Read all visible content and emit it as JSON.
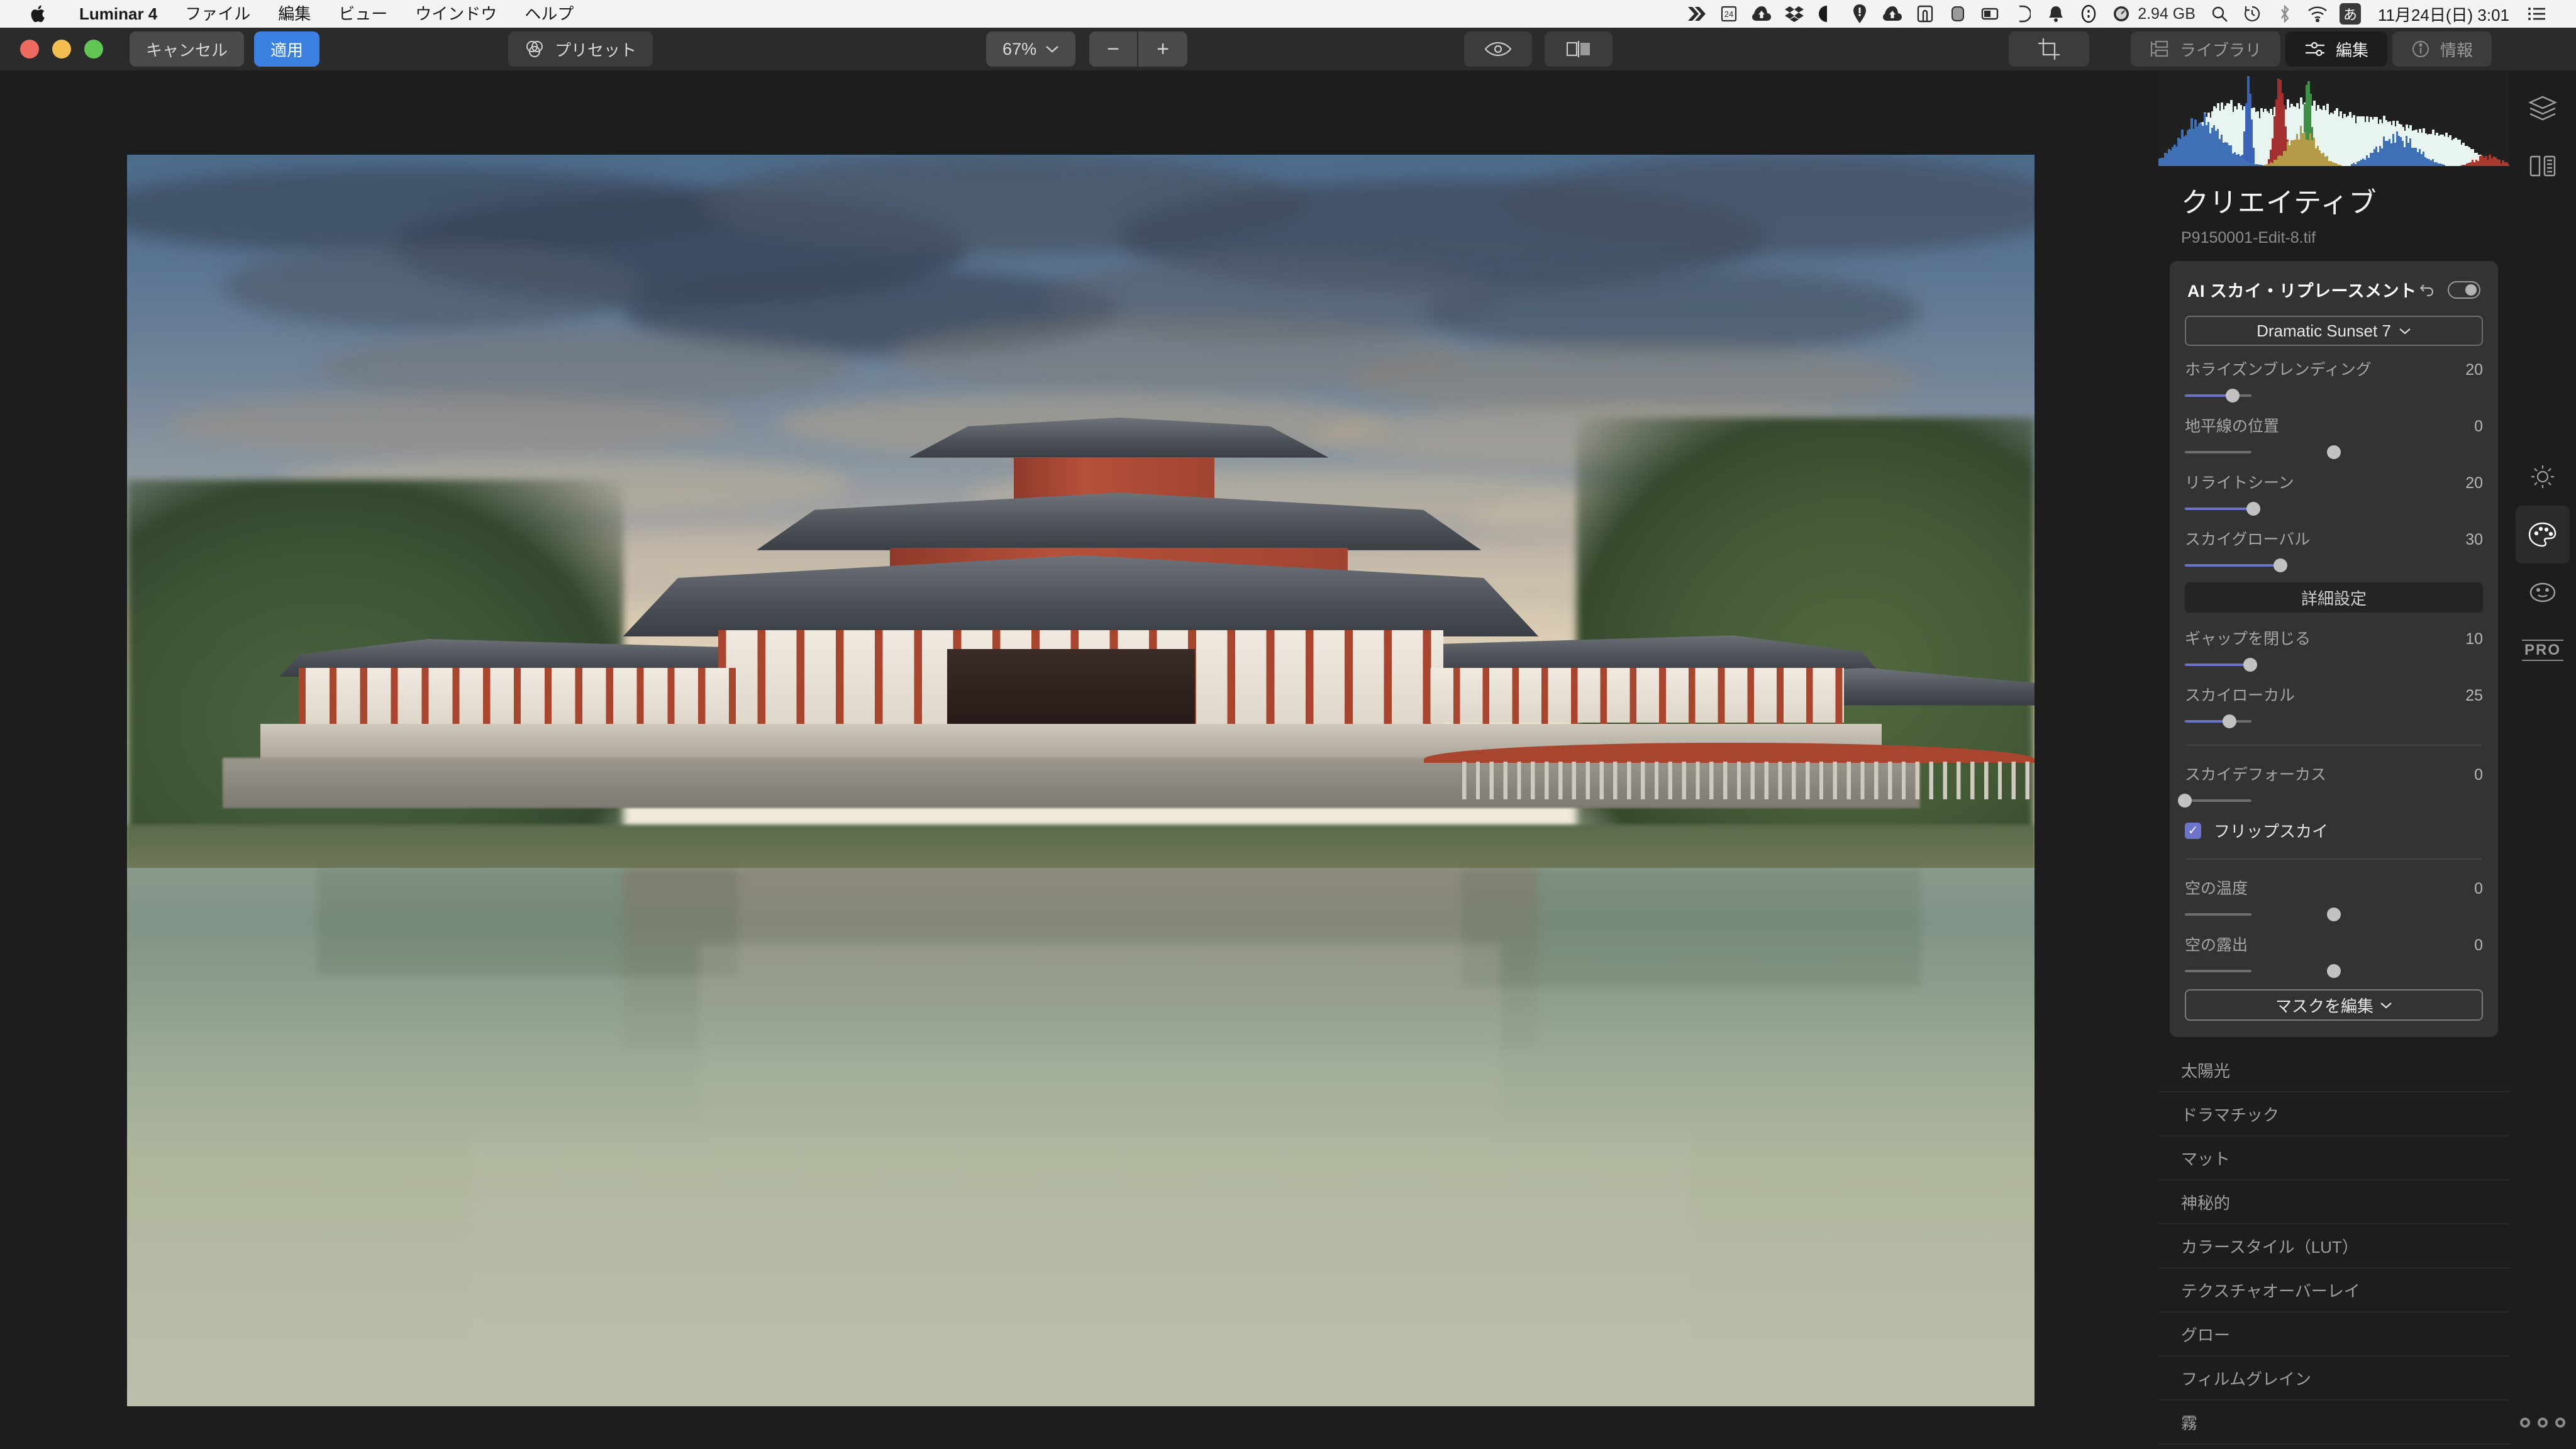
{
  "menubar": {
    "apple_icon": "apple-logo-icon",
    "items": [
      {
        "label": "Luminar 4",
        "bold": true
      },
      {
        "label": "ファイル",
        "bold": false
      },
      {
        "label": "編集",
        "bold": false
      },
      {
        "label": "ビュー",
        "bold": false
      },
      {
        "label": "ウインドウ",
        "bold": false
      },
      {
        "label": "ヘルプ",
        "bold": false
      }
    ],
    "status_icons": [
      "chevrons-right-icon",
      "calendar-24-icon",
      "cloud-upload-icon",
      "dropbox-icon",
      "pacman-icon",
      "location-pin-icon",
      "cloud-upload-2-icon",
      "clipboard-icon",
      "battery-round-icon",
      "battery-icon",
      "moon-icon",
      "bell-icon",
      "info-circle-icon",
      "speedometer-icon"
    ],
    "ram": "2.94 GB",
    "right_icons": [
      "search-icon",
      "time-machine-icon",
      "bluetooth-icon",
      "wifi-icon"
    ],
    "ime": "あ",
    "clock": "11月24日(日) 3:01",
    "control_center": "list-icon"
  },
  "toolbar": {
    "cancel_label": "キャンセル",
    "apply_label": "適用",
    "preset_label": "プリセット",
    "preset_icon": "presets-venn-icon",
    "zoom_value": "67%",
    "zoom_chevron": "chevron-down-icon",
    "zoom_out": "−",
    "zoom_in": "+",
    "eye_icon": "eye-icon",
    "compare_icon": "before-after-icon",
    "crop_icon": "crop-icon",
    "tabs": [
      {
        "label": "ライブラリ",
        "icon": "library-icon",
        "active": false
      },
      {
        "label": "編集",
        "icon": "sliders-icon",
        "active": true
      },
      {
        "label": "情報",
        "icon": "info-circle-icon",
        "active": false
      }
    ]
  },
  "panel": {
    "title": "クリエイティブ",
    "filename": "P9150001-Edit-8.tif",
    "card": {
      "name": "AI スカイ・リプレースメント",
      "undo_icon": "undo-icon",
      "toggle_icon": "toggle-on-icon",
      "sky_select": "Dramatic Sunset 7",
      "sky_select_chevron": "chevron-down-icon",
      "advanced_label": "詳細設定",
      "mask_label": "マスクを編集",
      "mask_chevron": "chevron-down-icon",
      "checkbox": {
        "label": "フリップスカイ",
        "checked": true,
        "mark": "✓"
      },
      "sliders_top": [
        {
          "label": "ホライズンブレンディング",
          "value": "20",
          "pct": 16,
          "filled": true
        },
        {
          "label": "地平線の位置",
          "value": "0",
          "pct": 50,
          "filled": false
        },
        {
          "label": "リライトシーン",
          "value": "20",
          "pct": 23,
          "filled": true
        },
        {
          "label": "スカイグローバル",
          "value": "30",
          "pct": 32,
          "filled": true
        }
      ],
      "sliders_mid": [
        {
          "label": "ギャップを閉じる",
          "value": "10",
          "pct": 22,
          "filled": true
        },
        {
          "label": "スカイローカル",
          "value": "25",
          "pct": 15,
          "filled": true
        }
      ],
      "sliders_focus": [
        {
          "label": "スカイデフォーカス",
          "value": "0",
          "pct": 0,
          "filled": false
        }
      ],
      "sliders_bottom": [
        {
          "label": "空の温度",
          "value": "0",
          "pct": 50,
          "filled": false
        },
        {
          "label": "空の露出",
          "value": "0",
          "pct": 50,
          "filled": false
        }
      ]
    },
    "filters": [
      {
        "label": "太陽光"
      },
      {
        "label": "ドラマチック"
      },
      {
        "label": "マット"
      },
      {
        "label": "神秘的"
      },
      {
        "label": "カラースタイル（LUT）"
      },
      {
        "label": "テクスチャオーバーレイ"
      },
      {
        "label": "グロー"
      },
      {
        "label": "フィルムグレイン"
      },
      {
        "label": "霧"
      }
    ]
  },
  "rail": {
    "icons": [
      {
        "name": "layers-icon",
        "selected": false
      },
      {
        "name": "compare-split-icon",
        "selected": false
      },
      {
        "name": "essentials-sun-icon",
        "selected": false
      },
      {
        "name": "creative-palette-icon",
        "selected": true
      },
      {
        "name": "portrait-face-icon",
        "selected": false
      },
      {
        "name": "pro-icon",
        "selected": false,
        "text": "PRO"
      }
    ],
    "more_dots": "more-options-icon"
  },
  "colors": {
    "accent_blue": "#3b7fe0",
    "slider_fill": "#6b74c9",
    "panel_bg": "#1d1d1d",
    "card_bg": "#333333",
    "toolbar_bg": "#2b2b2b",
    "menubar_bg": "#f3f3f3"
  },
  "photo": {
    "description": "Byodo-in Phoenix Hall temple reflected in pond at sunset"
  }
}
